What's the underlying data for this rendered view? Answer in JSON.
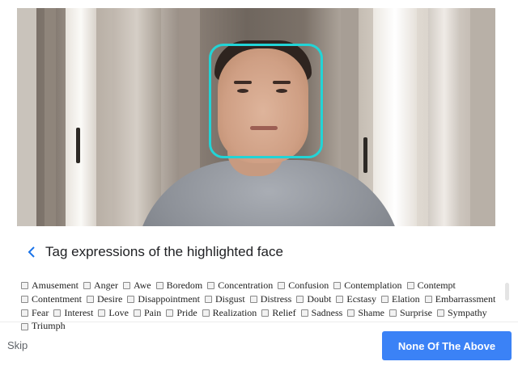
{
  "heading": {
    "back_icon": "chevron-left-icon",
    "title": "Tag expressions of the highlighted face"
  },
  "colors": {
    "accent": "#1a73e8",
    "face_highlight": "#22d4d6",
    "primary_button": "#3b82f6"
  },
  "tags": [
    "Amusement",
    "Anger",
    "Awe",
    "Boredom",
    "Concentration",
    "Confusion",
    "Contemplation",
    "Contempt",
    "Contentment",
    "Desire",
    "Disappointment",
    "Disgust",
    "Distress",
    "Doubt",
    "Ecstasy",
    "Elation",
    "Embarrassment",
    "Fear",
    "Interest",
    "Love",
    "Pain",
    "Pride",
    "Realization",
    "Relief",
    "Sadness",
    "Shame",
    "Surprise",
    "Sympathy",
    "Triumph"
  ],
  "footer": {
    "skip_label": "Skip",
    "none_label": "None Of The Above"
  }
}
